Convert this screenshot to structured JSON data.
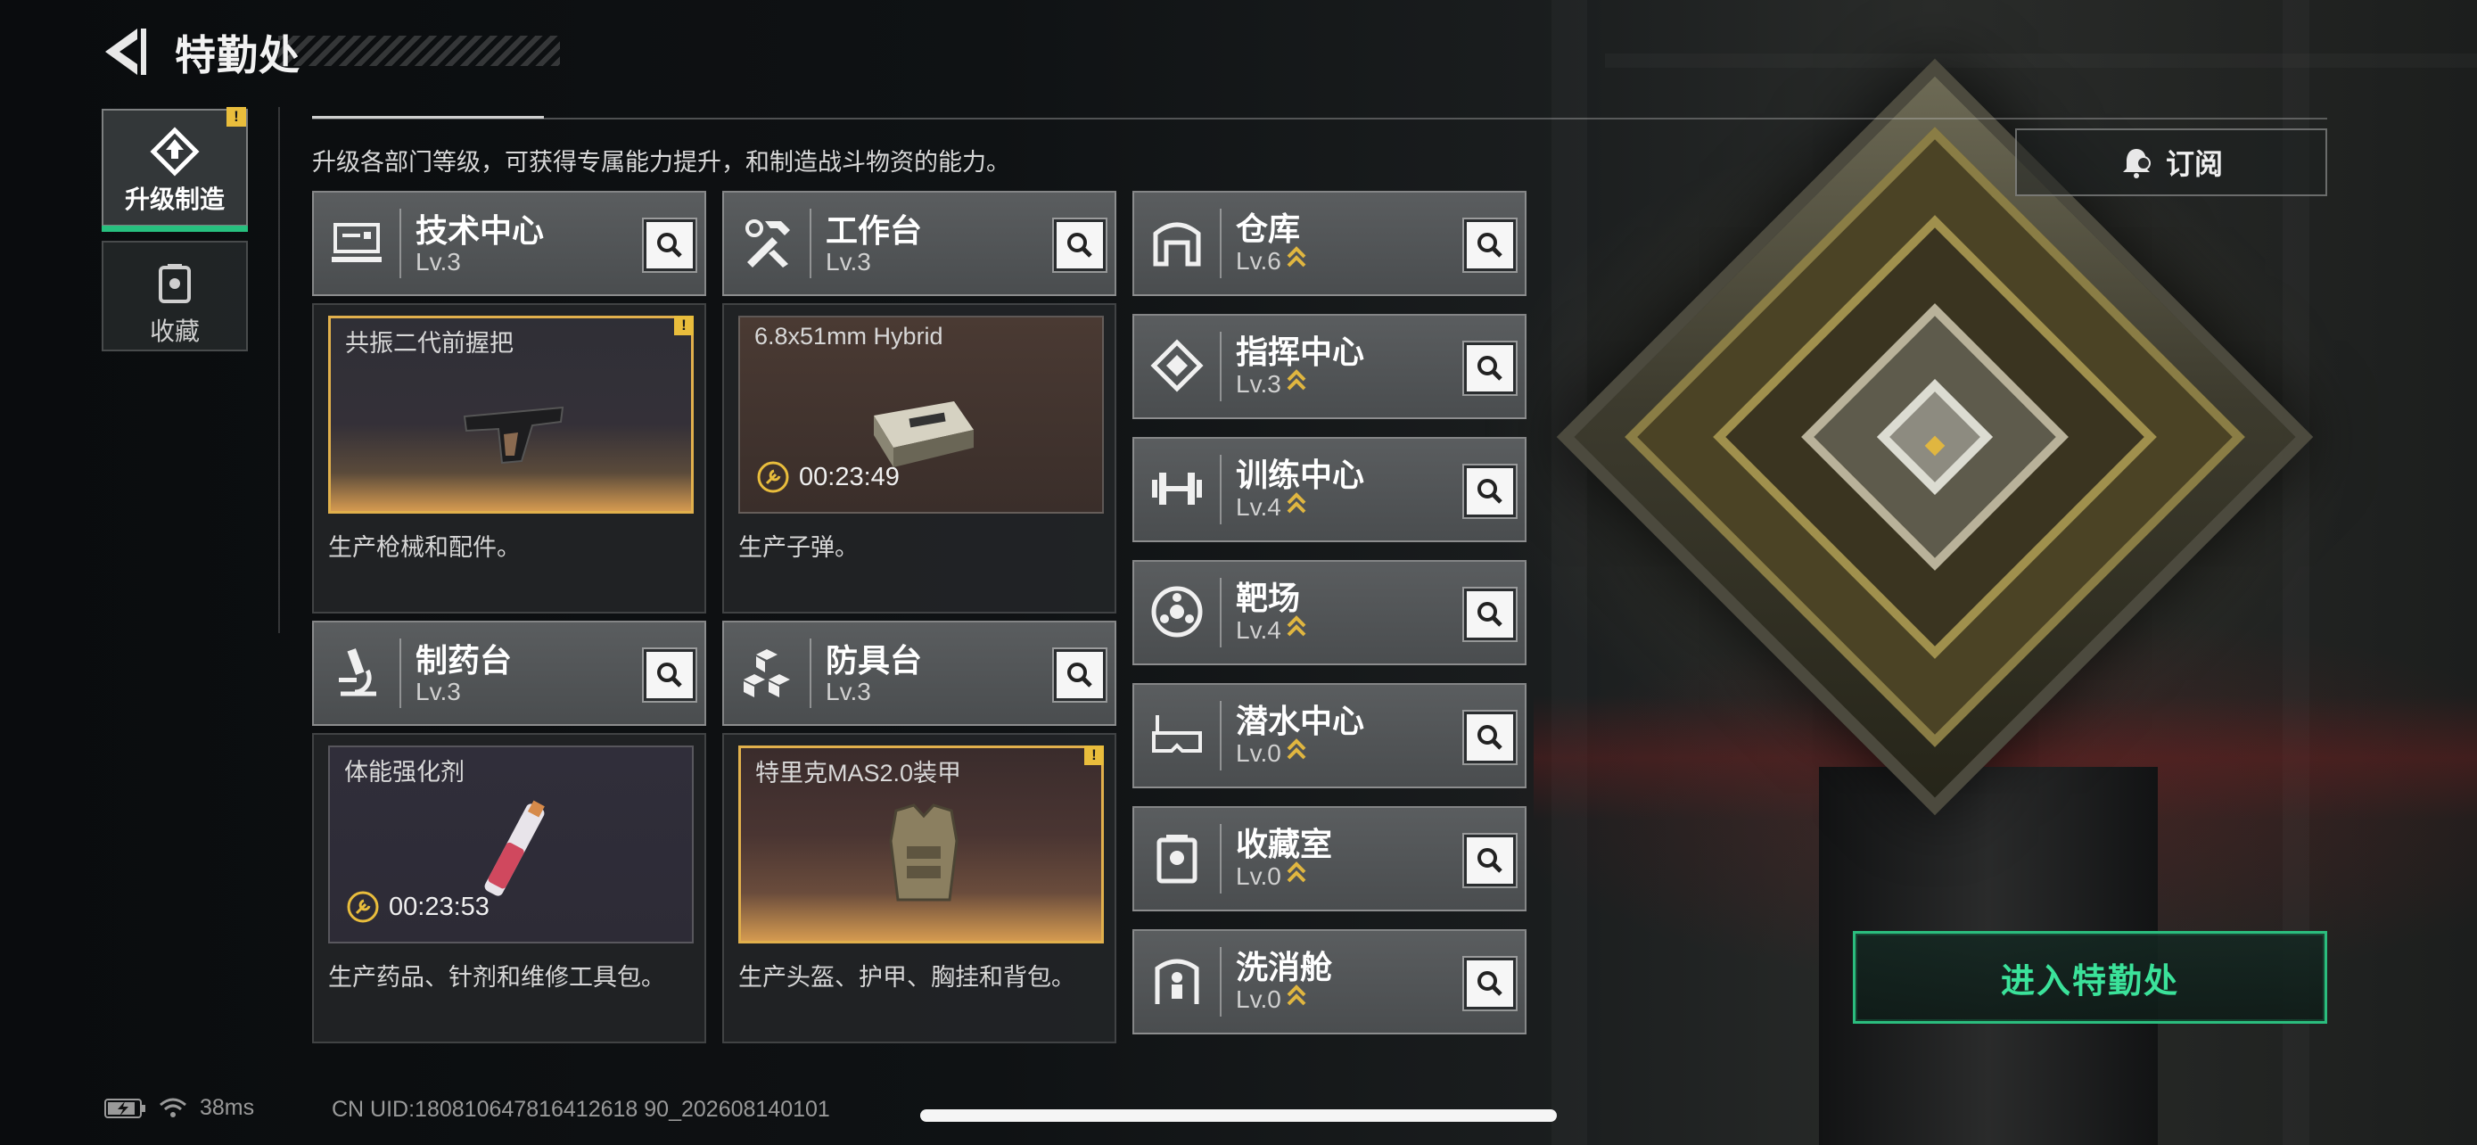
{
  "header": {
    "title": "特勤处"
  },
  "intro": "升级各部门等级，可获得专属能力提升，和制造战斗物资的能力。",
  "nav": [
    {
      "label": "升级制造",
      "active": true,
      "alert": "!"
    },
    {
      "label": "收藏",
      "active": false
    }
  ],
  "subscribe_label": "订阅",
  "facilities": [
    {
      "name": "技术中心",
      "level": "Lv.3",
      "product": "共振二代前握把",
      "product_alert": "!",
      "timer": "",
      "description": "生产枪械和配件。"
    },
    {
      "name": "工作台",
      "level": "Lv.3",
      "product": "6.8x51mm Hybrid",
      "timer": "00:23:49",
      "description": "生产子弹。"
    },
    {
      "name": "制药台",
      "level": "Lv.3",
      "product": "体能强化剂",
      "timer": "00:23:53",
      "description": "生产药品、针剂和维修工具包。"
    },
    {
      "name": "防具台",
      "level": "Lv.3",
      "product": "特里克MAS2.0装甲",
      "product_alert": "!",
      "timer": "",
      "description": "生产头盔、护甲、胸挂和背包。"
    }
  ],
  "rooms": [
    {
      "name": "仓库",
      "level": "Lv.6"
    },
    {
      "name": "指挥中心",
      "level": "Lv.3"
    },
    {
      "name": "训练中心",
      "level": "Lv.4"
    },
    {
      "name": "靶场",
      "level": "Lv.4"
    },
    {
      "name": "潜水中心",
      "level": "Lv.0"
    },
    {
      "name": "收藏室",
      "level": "Lv.0"
    },
    {
      "name": "洗消舱",
      "level": "Lv.0"
    }
  ],
  "enter_label": "进入特勤处",
  "status": {
    "ping": "38ms",
    "uid": "CN UID:180810647816412618 90_202608140101"
  },
  "colors": {
    "accent_green": "#2bbd7e",
    "alert_yellow": "#e9bd3c",
    "levelup_gold": "#e0b640"
  }
}
